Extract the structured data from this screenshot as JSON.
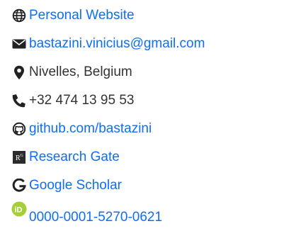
{
  "contacts": [
    {
      "icon": "globe-icon",
      "label": "Personal Website",
      "type": "link"
    },
    {
      "icon": "envelope-icon",
      "label": "bastazini.vinicius@gmail.com",
      "type": "link"
    },
    {
      "icon": "map-marker-icon",
      "label": "Nivelles, Belgium",
      "type": "text"
    },
    {
      "icon": "phone-icon",
      "label": "+32 474 13 95 53",
      "type": "text"
    },
    {
      "icon": "github-icon",
      "label": "github.com/bastazini",
      "type": "link"
    },
    {
      "icon": "researchgate-icon",
      "label": "Research Gate",
      "type": "link"
    },
    {
      "icon": "google-icon",
      "label": "Google Scholar",
      "type": "link"
    },
    {
      "icon": "orcid-icon",
      "label": "0000-0001-5270-0621",
      "type": "link"
    }
  ],
  "colors": {
    "link": "#0d6efd",
    "text": "#333333",
    "icon": "#222222",
    "orcid": "#a6ce39"
  }
}
